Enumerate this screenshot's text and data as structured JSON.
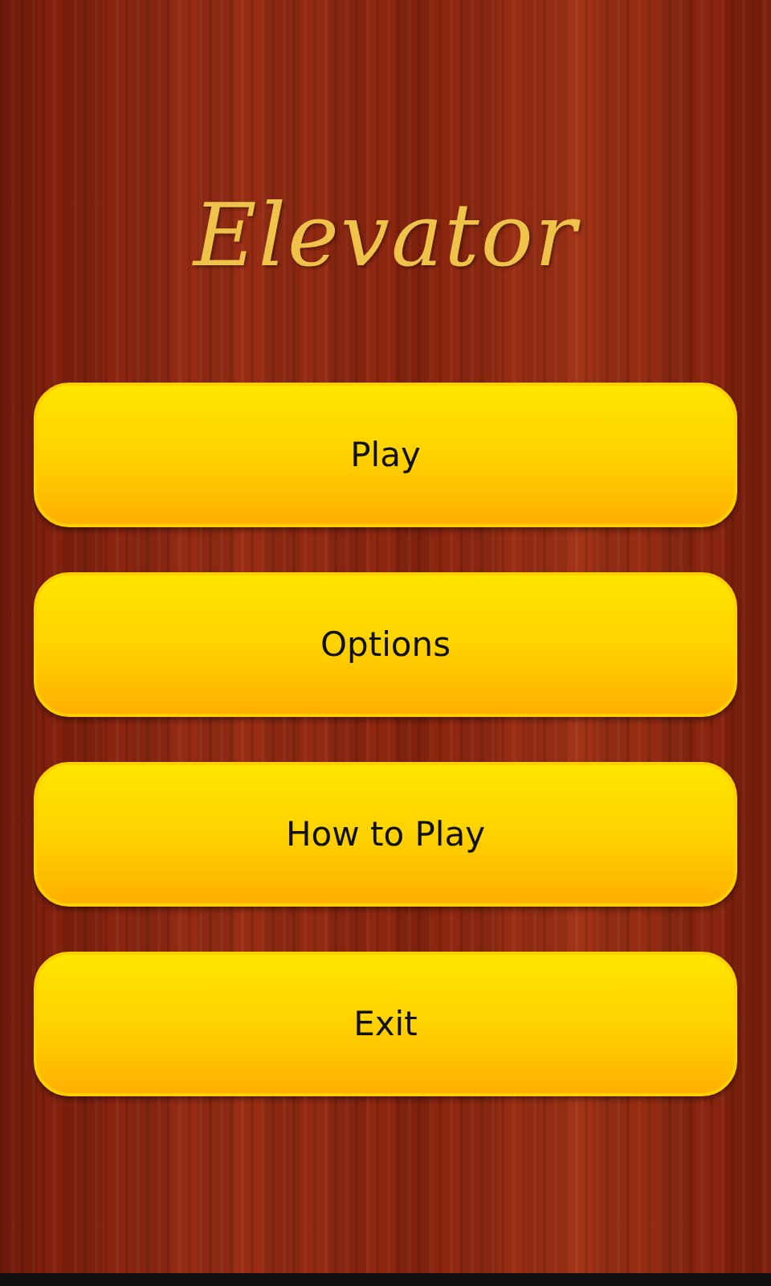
{
  "title": "Elevator",
  "buttons": [
    {
      "label": "Play"
    },
    {
      "label": "Options"
    },
    {
      "label": "How to Play"
    },
    {
      "label": "Exit"
    }
  ]
}
